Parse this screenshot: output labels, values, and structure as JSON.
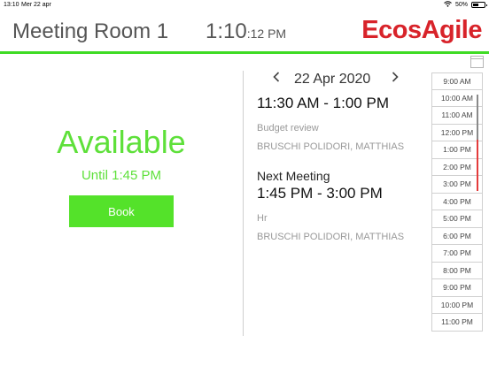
{
  "status_bar": {
    "time": "13:10",
    "date": "Mer 22 apr",
    "battery": "50%",
    "battery_level": 0.5
  },
  "header": {
    "room_name": "Meeting Room 1",
    "clock_hm": "1:10",
    "clock_suffix": ":12 PM",
    "logo_text": "EcosAgile"
  },
  "availability": {
    "status": "Available",
    "until": "Until 1:45 PM",
    "book_label": "Book"
  },
  "schedule": {
    "date": "22 Apr 2020",
    "current": {
      "time": "11:30 AM - 1:00 PM",
      "subject": "Budget review",
      "organizer": "BRUSCHI POLIDORI, MATTHIAS"
    },
    "next_label": "Next Meeting",
    "next": {
      "time": "1:45 PM - 3:00 PM",
      "subject": "Hr",
      "organizer": "BRUSCHI POLIDORI, MATTHIAS"
    }
  },
  "timeline": {
    "slots": [
      "9:00 AM",
      "10:00 AM",
      "11:00 AM",
      "12:00 PM",
      "1:00 PM",
      "2:00 PM",
      "3:00 PM",
      "4:00 PM",
      "5:00 PM",
      "6:00 PM",
      "7:00 PM",
      "8:00 PM",
      "9:00 PM",
      "10:00 PM",
      "11:00 PM"
    ]
  },
  "colors": {
    "accent_green": "#54e22a",
    "brand_red": "#d8232a",
    "busy_red": "#e43b3b"
  },
  "icons": {
    "wifi": "wifi-icon",
    "battery": "battery-icon",
    "prev": "chevron-left-icon",
    "next": "chevron-right-icon",
    "calendar": "calendar-icon"
  }
}
